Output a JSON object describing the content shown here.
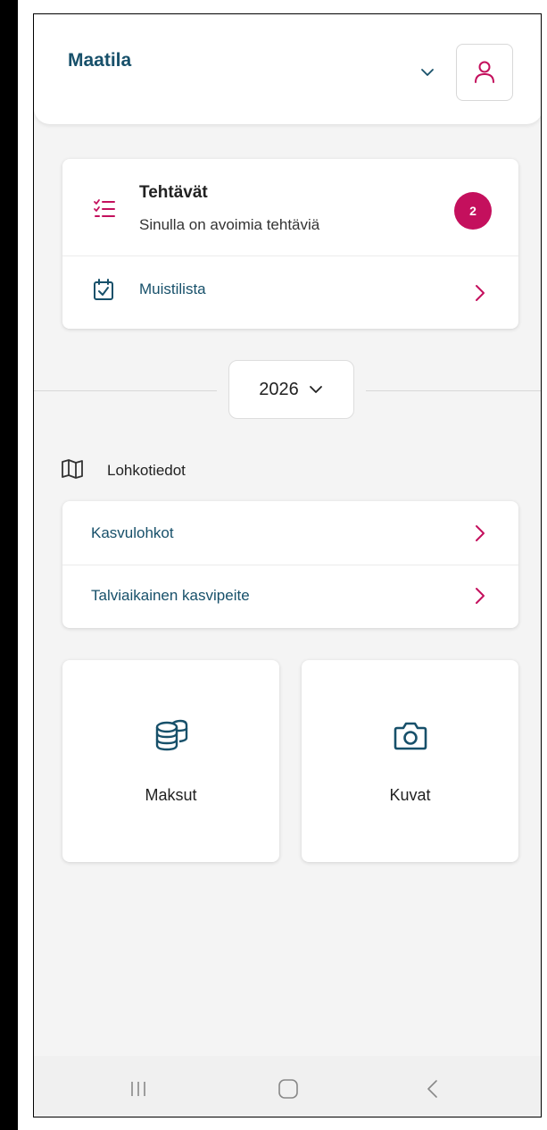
{
  "header": {
    "title": "Maatila",
    "farm_dropdown_icon": "chevron-down-icon",
    "user_icon": "user-icon"
  },
  "tasks": {
    "title": "Tehtävät",
    "subtitle": "Sinulla on avoimia tehtäviä",
    "badge_count": "2",
    "icon": "checklist-icon"
  },
  "memo": {
    "label": "Muistilista",
    "icon": "calendar-check-icon"
  },
  "year_selector": {
    "value": "2026",
    "icon": "chevron-down-icon"
  },
  "section": {
    "title": "Lohkotiedot",
    "icon": "map-icon"
  },
  "block_links": [
    {
      "label": "Kasvulohkot"
    },
    {
      "label": "Talviaikainen kasvipeite"
    }
  ],
  "tiles": [
    {
      "label": "Maksut",
      "icon": "coins-icon"
    },
    {
      "label": "Kuvat",
      "icon": "camera-icon"
    }
  ],
  "navbar": {
    "items": [
      "recent-apps-icon",
      "home-icon",
      "back-icon"
    ]
  },
  "colors": {
    "primary_text": "#17506a",
    "accent": "#c4105d",
    "background": "#f4f4f4",
    "card": "#ffffff"
  }
}
